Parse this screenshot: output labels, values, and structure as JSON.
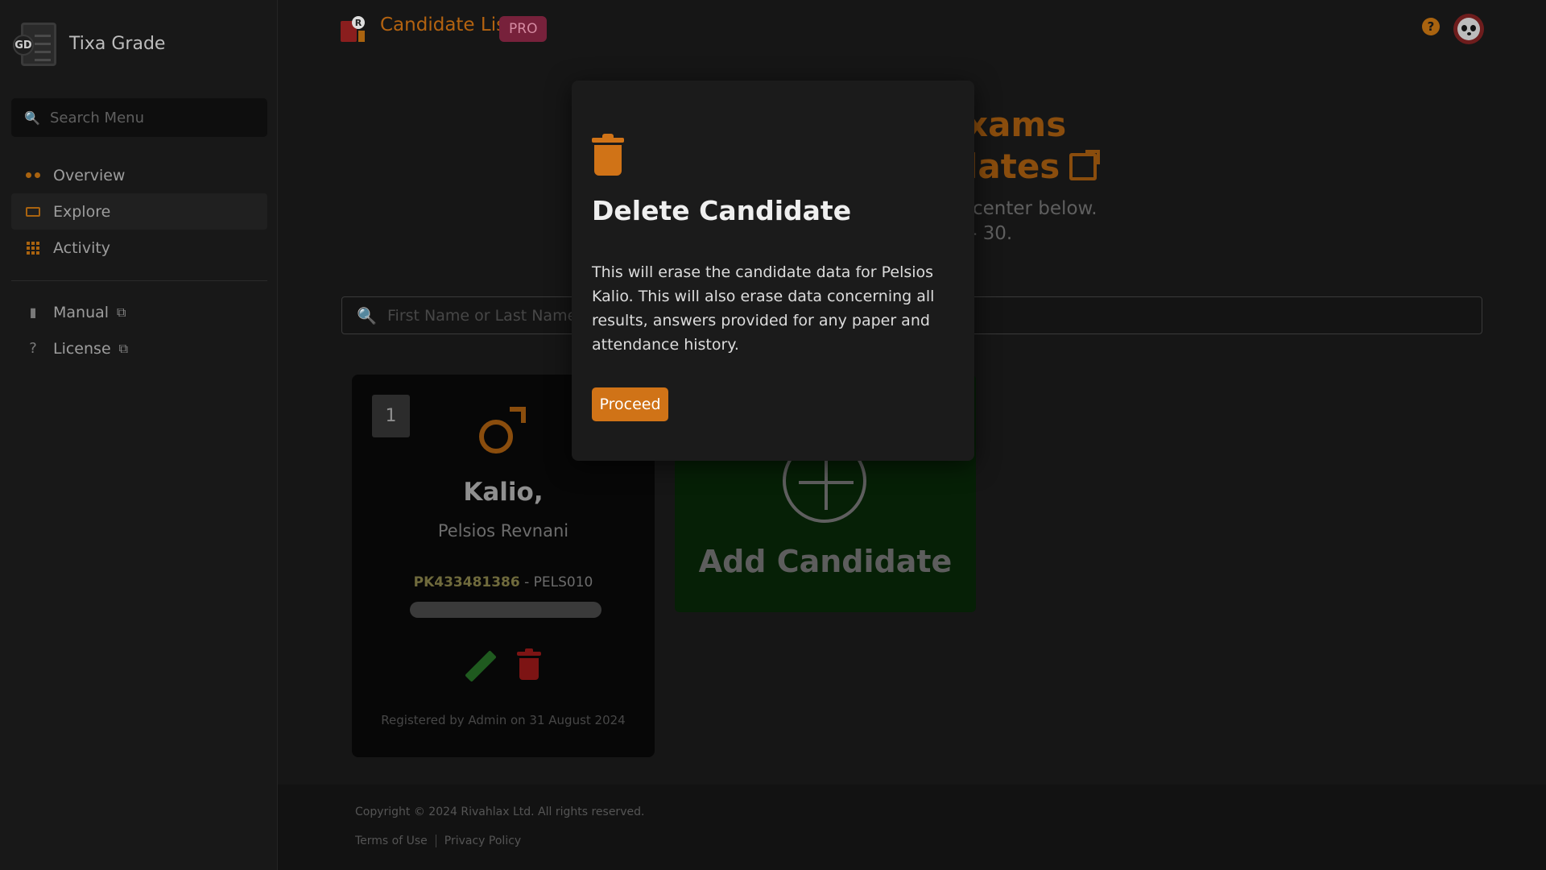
{
  "sidebar": {
    "brand_badge": "GD",
    "brand_name": "Tixa Grade",
    "search_placeholder": "Search Menu",
    "nav": [
      {
        "label": "Overview"
      },
      {
        "label": "Explore"
      },
      {
        "label": "Activity"
      }
    ],
    "links": [
      {
        "label": "Manual"
      },
      {
        "label": "License"
      }
    ]
  },
  "header": {
    "title": "Candidate List",
    "badge": "PRO",
    "icon_letter": "R",
    "help": "?"
  },
  "main": {
    "hero_line1": "xams",
    "hero_line2": "lates",
    "hero_sub1": "center below.",
    "hero_sub2": "- 30.",
    "search_placeholder": "First Name or Last Name",
    "candidate": {
      "index": "1",
      "last_name": "Kalio,",
      "first_names": "Pelsios Revnani",
      "id": "PK433481386",
      "separator": " - ",
      "code": "PELS010",
      "registered": "Registered by Admin on 31 August 2024"
    },
    "add_label": "Add Candidate"
  },
  "footer": {
    "copyright": "Copyright © 2024 Rivahlax Ltd. All rights reserved.",
    "terms": "Terms of Use",
    "privacy": "Privacy Policy"
  },
  "modal": {
    "title": "Delete Candidate",
    "body": "This will erase the candidate data for Pelsios Kalio. This will also erase data concerning all results, answers provided for any paper and attendance history.",
    "proceed": "Proceed"
  },
  "colors": {
    "accent": "#d07317",
    "danger": "#7d1414",
    "success": "#1f5a1f",
    "pro_badge": "#77213b"
  }
}
